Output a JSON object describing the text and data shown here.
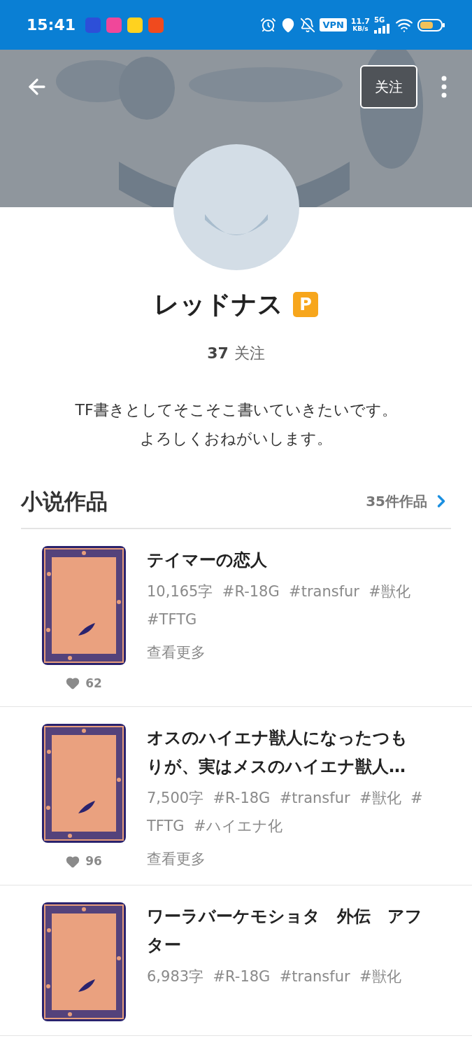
{
  "status_bar": {
    "time": "15:41",
    "vpn": "VPN",
    "speed": "11.7",
    "speed_unit": "KB/s",
    "network": "5G"
  },
  "header": {
    "follow_button": "关注"
  },
  "profile": {
    "name": "レッドナス",
    "badge": "P",
    "following_count": "37",
    "following_label": "关注",
    "bio": [
      "TF書きとしてそこそこ書いていきたいです。",
      "よろしくおねがいします。"
    ]
  },
  "section": {
    "title": "小说作品",
    "count": "35件作品"
  },
  "works": [
    {
      "title": "テイマーの恋人",
      "meta": "10,165字  #R-18G  #transfur  #獣化  #TFTG",
      "more": "查看更多",
      "likes": "62"
    },
    {
      "title": "オスのハイエナ獣人になったつもりが、実はメスのハイエナ獣人…",
      "meta": "7,500字  #R-18G  #transfur  #獣化  #TFTG  #ハイエナ化",
      "more": "查看更多",
      "likes": "96"
    },
    {
      "title": "ワーラバーケモショタ　外伝　アフター",
      "meta": "6,983字  #R-18G  #transfur  #獣化"
    }
  ]
}
